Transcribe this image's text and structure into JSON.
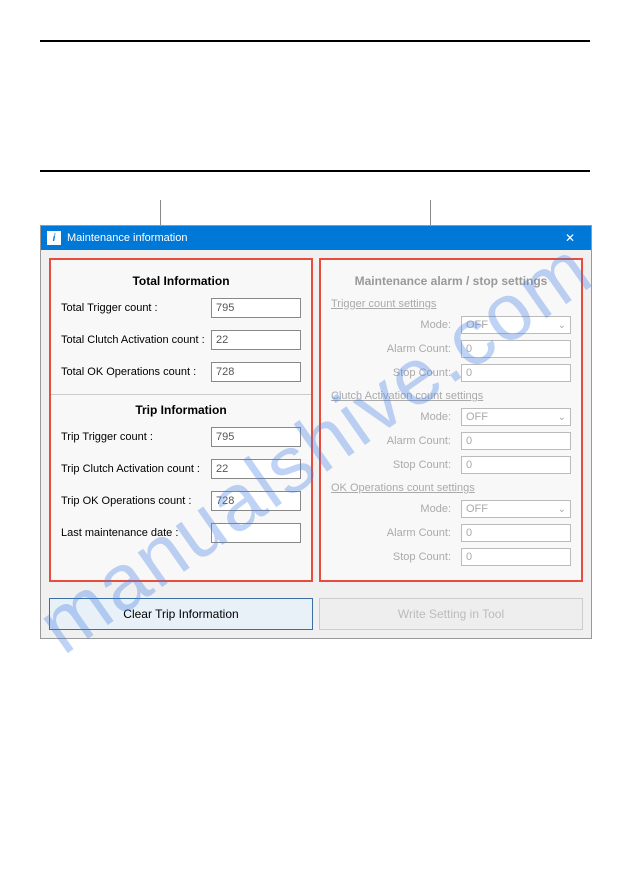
{
  "watermark": "manualshive.com",
  "window": {
    "title": "Maintenance information",
    "icon_label": "i"
  },
  "left_panel": {
    "total_title": "Total Information",
    "total_fields": [
      {
        "label": "Total Trigger count :",
        "value": "795"
      },
      {
        "label": "Total Clutch Activation count :",
        "value": "22"
      },
      {
        "label": "Total OK Operations count :",
        "value": "728"
      }
    ],
    "trip_title": "Trip Information",
    "trip_fields": [
      {
        "label": "Trip Trigger count :",
        "value": "795"
      },
      {
        "label": "Trip Clutch Activation count :",
        "value": "22"
      },
      {
        "label": "Trip OK Operations count :",
        "value": "728"
      },
      {
        "label": "Last maintenance date :",
        "value": ""
      }
    ]
  },
  "right_panel": {
    "title": "Maintenance alarm / stop settings",
    "sections": [
      {
        "subtitle": "Trigger count settings",
        "rows": [
          {
            "label": "Mode:",
            "type": "select",
            "value": "OFF"
          },
          {
            "label": "Alarm Count:",
            "type": "input",
            "value": "0"
          },
          {
            "label": "Stop Count:",
            "type": "input",
            "value": "0"
          }
        ]
      },
      {
        "subtitle": "Clutch Activation count settings",
        "rows": [
          {
            "label": "Mode:",
            "type": "select",
            "value": "OFF"
          },
          {
            "label": "Alarm Count:",
            "type": "input",
            "value": "0"
          },
          {
            "label": "Stop Count:",
            "type": "input",
            "value": "0"
          }
        ]
      },
      {
        "subtitle": "OK Operations count settings",
        "rows": [
          {
            "label": "Mode:",
            "type": "select",
            "value": "OFF"
          },
          {
            "label": "Alarm Count:",
            "type": "input",
            "value": "0"
          },
          {
            "label": "Stop Count:",
            "type": "input",
            "value": "0"
          }
        ]
      }
    ]
  },
  "buttons": {
    "clear": "Clear Trip Information",
    "write": "Write Setting in Tool"
  }
}
